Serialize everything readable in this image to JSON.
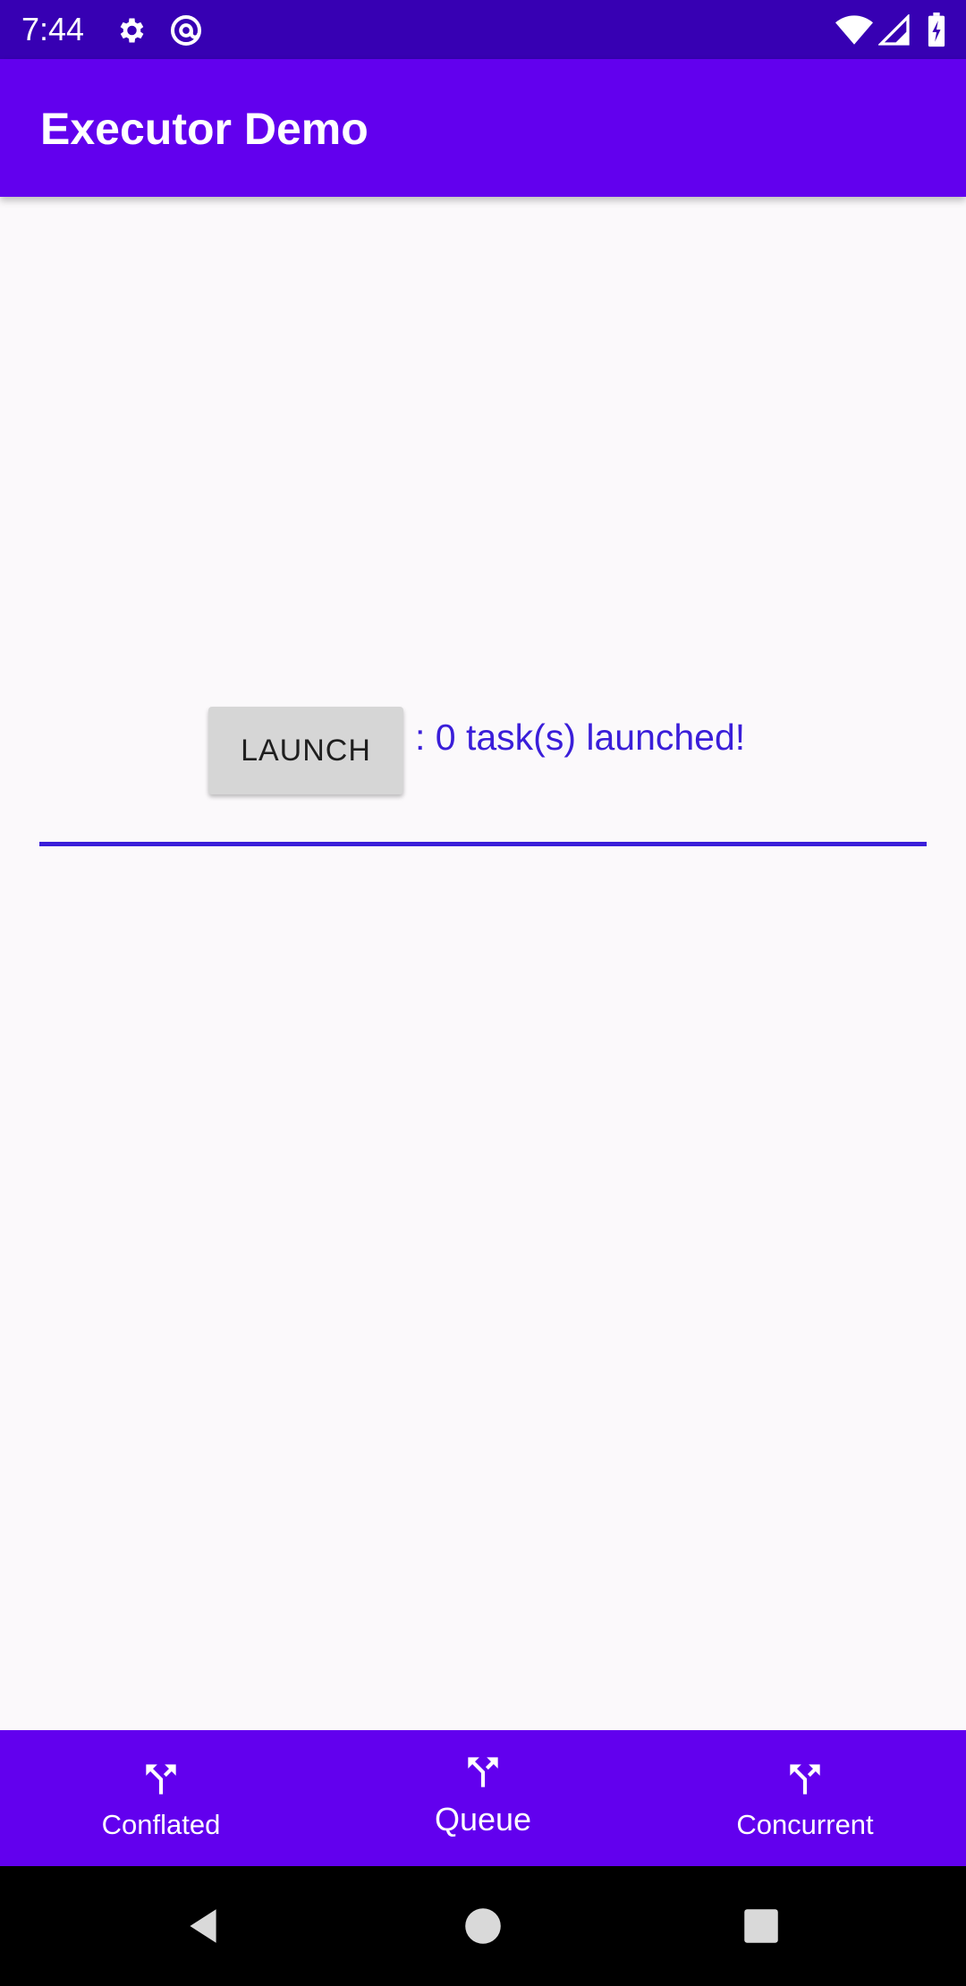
{
  "status_bar": {
    "time": "7:44",
    "icons": [
      "settings-icon",
      "at-sign-icon",
      "wifi-icon",
      "cellular-signal-icon",
      "battery-icon"
    ]
  },
  "app_bar": {
    "title": "Executor Demo",
    "background_color": "#6200ee"
  },
  "main": {
    "launch_button_label": "LAUNCH",
    "status_text": ": 0 task(s) launched!",
    "accent_color": "#3a1ed9"
  },
  "bottom_nav": {
    "items": [
      {
        "label": "Conflated",
        "icon": "fork-arrows-icon",
        "selected": false
      },
      {
        "label": "Queue",
        "icon": "fork-arrows-icon",
        "selected": true
      },
      {
        "label": "Concurrent",
        "icon": "fork-arrows-icon",
        "selected": false
      }
    ]
  },
  "system_nav": {
    "icons": [
      "back-icon",
      "home-icon",
      "recents-icon"
    ]
  }
}
